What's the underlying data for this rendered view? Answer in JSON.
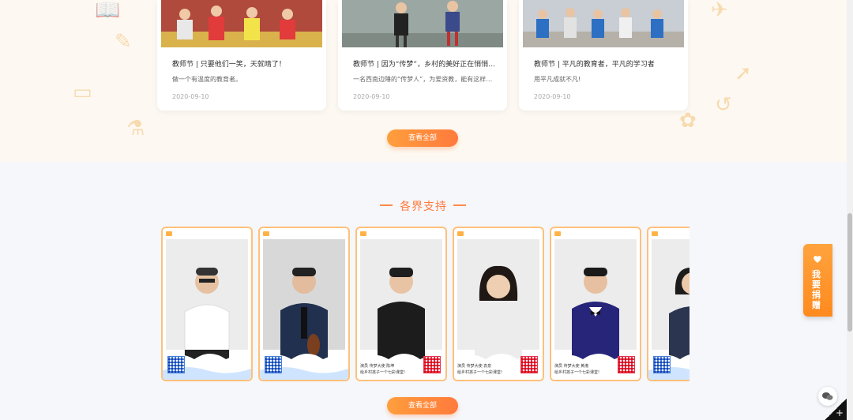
{
  "news": {
    "cards": [
      {
        "title": "教师节 | 只要他们一笑，天就晴了！",
        "desc": "做一个有温度的教育者。",
        "date": "2020-09-10"
      },
      {
        "title": "教师节 | 因为“传梦”，乡村的美好正在悄悄发生",
        "desc": "一名西南边陲的“传梦人”，为爱资教，能有这样的初心",
        "date": "2020-09-10"
      },
      {
        "title": "教师节 | 平凡的教育者，平凡的学习者",
        "desc": "用平凡成就不凡!",
        "date": "2020-09-10"
      }
    ],
    "view_all": "查看全部"
  },
  "support": {
    "title": "各界支持",
    "view_all": "查看全部",
    "posters": [
      {
        "caption": "",
        "slogan": ""
      },
      {
        "caption": "",
        "slogan": ""
      },
      {
        "caption": "演员 传梦大使 陈坤",
        "slogan": "给乡村孩子一个七彩课堂!"
      },
      {
        "caption": "演员 传梦大使 袁泉",
        "slogan": "给乡村孩子一个七彩课堂!"
      },
      {
        "caption": "演员 传梦大使 黄渤",
        "slogan": "给乡村孩子一个七彩课堂!"
      },
      {
        "caption": "",
        "slogan": ""
      }
    ]
  },
  "float": {
    "donate": "我要捐赠",
    "wechat_icon": "wechat-icon"
  },
  "colors": {
    "accent": "#ff7a3c",
    "poster_border": "#ffc07a",
    "donate_bg": "#ff9a2e"
  }
}
